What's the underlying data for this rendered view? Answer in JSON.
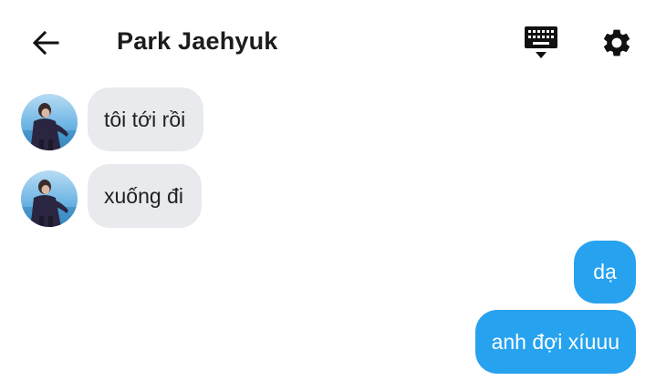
{
  "header": {
    "contact_name": "Park Jaehyuk",
    "back_icon": "back-arrow-icon",
    "keyboard_icon": "keyboard-icon",
    "settings_icon": "gear-icon"
  },
  "messages": [
    {
      "direction": "incoming",
      "text": "tôi tới rồi"
    },
    {
      "direction": "incoming",
      "text": "xuống đi"
    },
    {
      "direction": "outgoing",
      "text": "dạ"
    },
    {
      "direction": "outgoing",
      "text": "anh đợi xíuuu"
    }
  ],
  "colors": {
    "incoming_bubble": "#e8eaed",
    "outgoing_bubble": "#27a2ef",
    "text_dark": "#202124"
  }
}
